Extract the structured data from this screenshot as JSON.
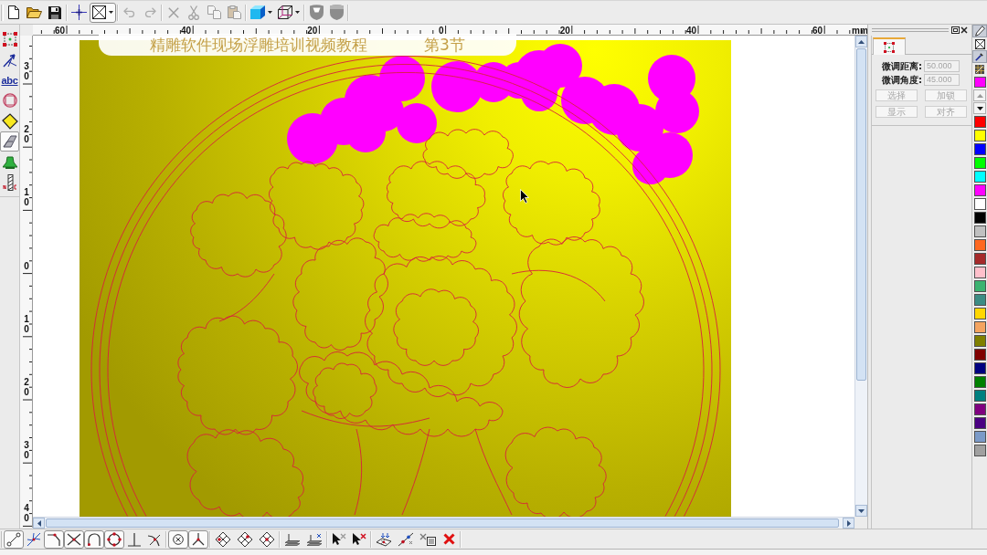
{
  "top_toolbar": {
    "groups": [
      {
        "buttons": [
          {
            "pressed": false,
            "disabled": false
          },
          {
            "pressed": false,
            "disabled": false
          },
          {
            "pressed": false,
            "disabled": false
          }
        ]
      },
      {
        "buttons": [
          {
            "pressed": false,
            "disabled": false
          },
          {
            "pressed": true,
            "disabled": false
          }
        ]
      },
      {
        "buttons": [
          {
            "pressed": false,
            "disabled": true
          },
          {
            "pressed": false,
            "disabled": true
          }
        ]
      },
      {
        "buttons": [
          {
            "pressed": false,
            "disabled": true
          },
          {
            "pressed": false,
            "disabled": true
          },
          {
            "pressed": false,
            "disabled": true
          },
          {
            "pressed": false,
            "disabled": true
          }
        ]
      },
      {
        "buttons": [
          {
            "pressed": false,
            "disabled": false
          },
          {
            "pressed": false,
            "disabled": false
          }
        ]
      },
      {
        "buttons": [
          {
            "pressed": false,
            "disabled": false
          },
          {
            "pressed": false,
            "disabled": false
          }
        ]
      }
    ]
  },
  "left_tools": [
    {
      "selected": false
    },
    {
      "selected": false
    },
    {
      "selected": false,
      "text": "abc"
    },
    {
      "selected": false
    },
    {
      "selected": false
    },
    {
      "selected": true
    },
    {
      "selected": false
    },
    {
      "selected": false
    }
  ],
  "horizontal_ruler": {
    "labels": [
      "60",
      "40",
      "20",
      "0",
      "20",
      "40",
      "60"
    ],
    "unit": "mm"
  },
  "vertical_ruler": {
    "labels": [
      "30",
      "20",
      "10",
      "0",
      "10",
      "20",
      "30",
      "40"
    ]
  },
  "canvas": {
    "title": "精雕软件现场浮雕培训视频教程",
    "episode": "第3节"
  },
  "side_panel": {
    "tabs": [
      {
        "selected": true
      }
    ],
    "fields": [
      {
        "label": "微调距离:",
        "value": "50.000",
        "disabled": true
      },
      {
        "label": "微调角度:",
        "value": "45.000",
        "disabled": true
      }
    ],
    "buttons": [
      {
        "label": "选择",
        "disabled": true
      },
      {
        "label": "加锁",
        "disabled": true
      },
      {
        "label": "显示",
        "disabled": true
      },
      {
        "label": "对齐",
        "disabled": true
      }
    ]
  },
  "palette": {
    "tools": [
      {
        "pressed": true
      },
      {
        "pressed": false
      },
      {
        "pressed": true
      },
      {
        "pressed": false
      }
    ],
    "current": {
      "color": "#ff00ff"
    },
    "swatches": [
      {
        "color": "#ff0000"
      },
      {
        "color": "#ffff00"
      },
      {
        "color": "#0000ff"
      },
      {
        "color": "#00ff00"
      },
      {
        "color": "#00ffff"
      },
      {
        "color": "#ff00ff"
      },
      {
        "color": "#ffffff"
      },
      {
        "color": "#000000"
      },
      {
        "color": "#c0c0c0"
      },
      {
        "color": "#ff6820"
      },
      {
        "color": "#a52a2a"
      },
      {
        "color": "#ffc0cb"
      },
      {
        "color": "#3cb371"
      },
      {
        "color": "#3c8c84"
      },
      {
        "color": "#ffd700"
      },
      {
        "color": "#f4a460"
      },
      {
        "color": "#808000"
      },
      {
        "color": "#800000"
      },
      {
        "color": "#000080"
      },
      {
        "color": "#008000"
      },
      {
        "color": "#008080"
      },
      {
        "color": "#800080"
      },
      {
        "color": "#4b0082"
      },
      {
        "color": "#7b9ac8"
      },
      {
        "color": "#a0a0a0"
      }
    ]
  },
  "bottom_toolbar": {
    "groups": [
      {
        "buttons": [
          {
            "on": true
          },
          {
            "on": false
          },
          {
            "on": true
          },
          {
            "on": true
          },
          {
            "on": true
          },
          {
            "on": true
          },
          {
            "on": false
          },
          {
            "on": false
          }
        ]
      },
      {
        "buttons": [
          {
            "on": true
          },
          {
            "on": true
          }
        ]
      },
      {
        "buttons": [
          {
            "on": false
          },
          {
            "on": false
          },
          {
            "on": false
          }
        ]
      },
      {
        "buttons": [
          {
            "on": false
          },
          {
            "on": false
          }
        ]
      },
      {
        "buttons": [
          {
            "on": false
          },
          {
            "on": false
          }
        ]
      },
      {
        "buttons": [
          {
            "on": false
          },
          {
            "on": false
          },
          {
            "on": false
          },
          {
            "on": false
          }
        ]
      }
    ]
  }
}
